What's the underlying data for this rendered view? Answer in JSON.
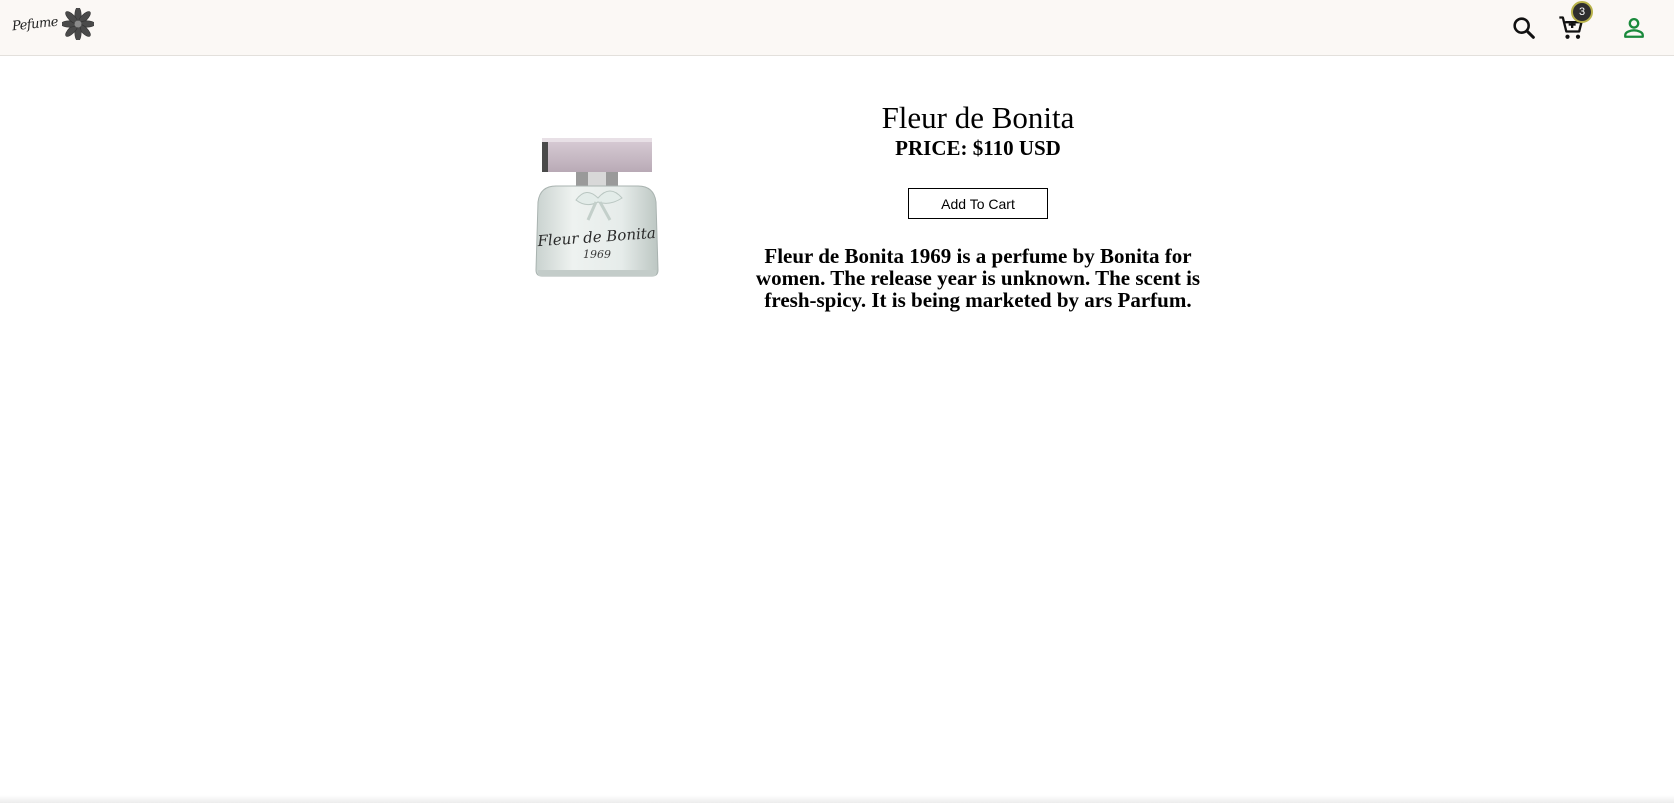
{
  "header": {
    "logo_text": "Pefume",
    "cart_count": "3",
    "colors": {
      "background": "#fbf8f5",
      "account_icon": "#1a8a3c",
      "badge": "#2f2f2f"
    },
    "icons": [
      "flower-logo-icon",
      "search-icon",
      "cart-icon",
      "account-icon"
    ]
  },
  "product": {
    "name": "Fleur de Bonita",
    "price": "PRICE: $110 USD",
    "add_to_cart_label": "Add To Cart",
    "description": "Fleur de Bonita 1969 is a perfume by Bonita for women. The release year is unknown. The scent is fresh-spicy. It is being marketed by ars Parfum.",
    "image_alt": "Fleur de Bonita perfume bottle",
    "bottle_label_line1": "Fleur de Bonita",
    "bottle_label_line2": "1969"
  }
}
